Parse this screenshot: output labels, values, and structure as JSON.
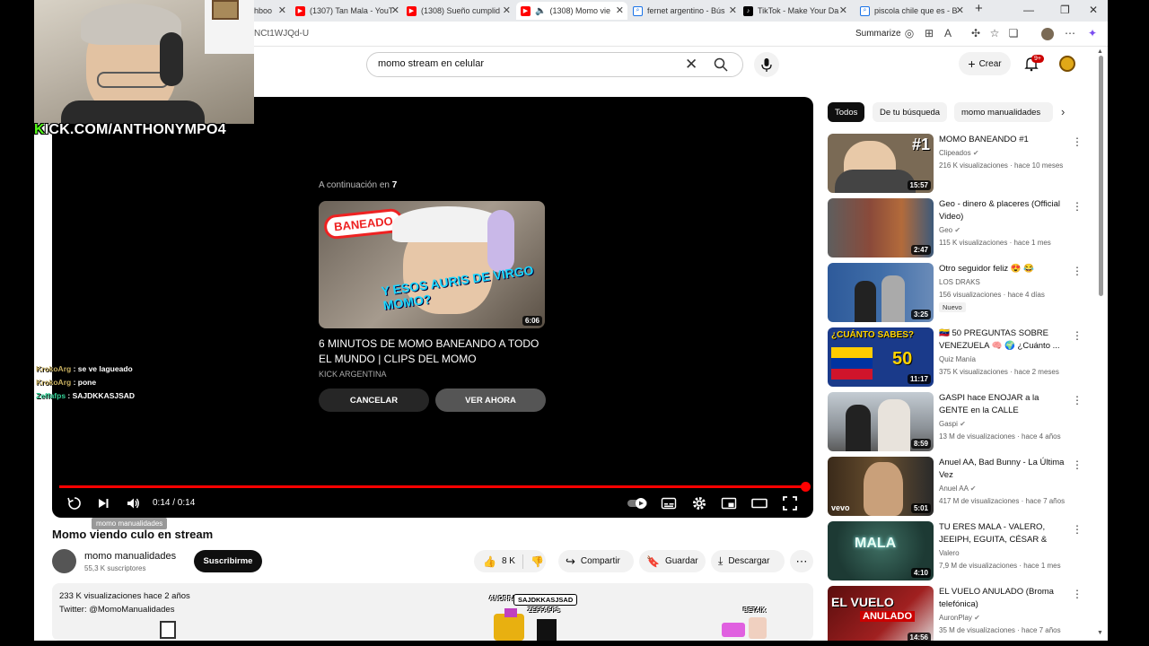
{
  "browser": {
    "tabs": [
      {
        "label": "hboo",
        "icon": "tab-icon",
        "color": "#888888"
      },
      {
        "label": "(1307) Tan Mala - YouT",
        "icon": "youtube-icon",
        "color": "#ff0000"
      },
      {
        "label": "(1308) Sueño cumplid",
        "icon": "youtube-icon",
        "color": "#ff0000"
      },
      {
        "label": "(1308) Momo vie",
        "icon": "youtube-icon",
        "color": "#ff0000",
        "active": true
      },
      {
        "label": "fernet argentino - Bús",
        "icon": "search-icon",
        "color": "#1a73e8"
      },
      {
        "label": "TikTok - Make Your Da",
        "icon": "tiktok-icon",
        "color": "#000000"
      },
      {
        "label": "piscola chile que es - B",
        "icon": "search-icon",
        "color": "#1a73e8"
      }
    ],
    "url": "NCt1WJQd-U",
    "summarize": "Summarize"
  },
  "youtube": {
    "search_value": "momo stream en celular",
    "crear": "Crear",
    "notif_count": "9+"
  },
  "player": {
    "upnext_prefix": "A continuación en",
    "upnext_seconds": "7",
    "thumb_text_1": "BANEADO",
    "thumb_text_2": "Y ESOS AURIS DE VIRGO MOMO?",
    "thumb_duration": "6:06",
    "upnext_title": "6 MINUTOS DE MOMO BANEANDO A TODO EL MUNDO | CLIPS DEL MOMO",
    "upnext_channel": "KICK ARGENTINA",
    "cancel": "CANCELAR",
    "watch_now": "VER AHORA",
    "time": "0:14 / 0:14",
    "progress": 1.0,
    "tooltip": "momo manualidades"
  },
  "video": {
    "title": "Momo viendo culo en stream",
    "channel": "momo manualidades",
    "subs": "55,3 K suscriptores",
    "subscribe": "Suscribirme",
    "likes": "8 K",
    "share": "Compartir",
    "save": "Guardar",
    "download": "Descargar",
    "stats": "233 K visualizaciones  hace 2 años",
    "twitter": "Twitter: @MomoManualidades"
  },
  "sidebar": {
    "chips": [
      "Todos",
      "De tu búsqueda",
      "momo manualidades"
    ],
    "items": [
      {
        "title": "MOMO BANEANDO #1",
        "channel": "Clipeados",
        "verified": true,
        "meta": "216 K visualizaciones · hace 10 meses",
        "duration": "15:57",
        "overlay": "#1",
        "bg": "#7a6a55"
      },
      {
        "title": "Geo - dinero & placeres (Official Video)",
        "channel": "Geo",
        "verified": true,
        "meta": "115 K visualizaciones · hace 1 mes",
        "duration": "2:47",
        "overlay": "",
        "bg": "#8a4a3a"
      },
      {
        "title": "Otro seguidor feliz 😍 😂",
        "channel": "LOS DRAKS",
        "verified": false,
        "meta": "156 visualizaciones · hace 4 días",
        "badge": "Nuevo",
        "duration": "3:25",
        "overlay": "",
        "bg": "#3f6da8"
      },
      {
        "title": "50 PREGUNTAS SOBRE VENEZUELA 🧠 🌍 ¿Cuánto ...",
        "prefix": "🇻🇪",
        "channel": "Quiz Manía",
        "verified": false,
        "meta": "375 K visualizaciones · hace 2 meses",
        "duration": "11:17",
        "overlay": "¿CUÁNTO SABES?",
        "overlay2": "50",
        "bg": "#1a3a8a"
      },
      {
        "title": "GASPI hace ENOJAR a la GENTE en la CALLE",
        "channel": "Gaspi",
        "verified": true,
        "meta": "13 M de visualizaciones · hace 4 años",
        "duration": "8:59",
        "overlay": "",
        "bg": "#9aa3ab"
      },
      {
        "title": "Anuel AA, Bad Bunny - La Última Vez",
        "channel": "Anuel AA",
        "verified": true,
        "meta": "417 M de visualizaciones · hace 7 años",
        "duration": "5:01",
        "overlay": "vevo",
        "bg": "#4a3a26"
      },
      {
        "title": "TU ERES MALA - VALERO, JEEIPH, EGUITA, CÉSAR & YO...",
        "channel": "Valero",
        "verified": false,
        "meta": "7,9 M de visualizaciones · hace 1 mes",
        "duration": "4:10",
        "overlay": "MALA",
        "bg": "#1d3a34"
      },
      {
        "title": "EL VUELO ANULADO (Broma telefónica)",
        "channel": "AuronPlay",
        "verified": true,
        "meta": "35 M de visualizaciones · hace 7 años",
        "duration": "14:56",
        "overlay": "EL VUELO",
        "overlay2": "ANULADO",
        "bg": "#7a1a1a"
      }
    ]
  },
  "stream": {
    "kick_k": "K",
    "kick_rest": "ICK.COM/ANTHONYMPO4",
    "chat": [
      {
        "user": "KrokoArg",
        "sep": " : ",
        "msg": "se ve lagueado",
        "color": "#c8b060"
      },
      {
        "user": "KrokoArg",
        "sep": " : ",
        "msg": "pone",
        "color": "#c8b060"
      },
      {
        "user": "Zeffafps",
        "sep": " : ",
        "msg": "SAJDKKASJSAD",
        "color": "#34d399"
      }
    ],
    "sprite_bubble": "SAJDKKASJSAD",
    "sprite_labels": [
      "ANORRA",
      "ZEFFAFPS",
      "BETAIX"
    ]
  },
  "colors": {
    "accent": "#ff0000",
    "kick_green": "#53fc18",
    "dark_button": "#0f0f0f"
  }
}
